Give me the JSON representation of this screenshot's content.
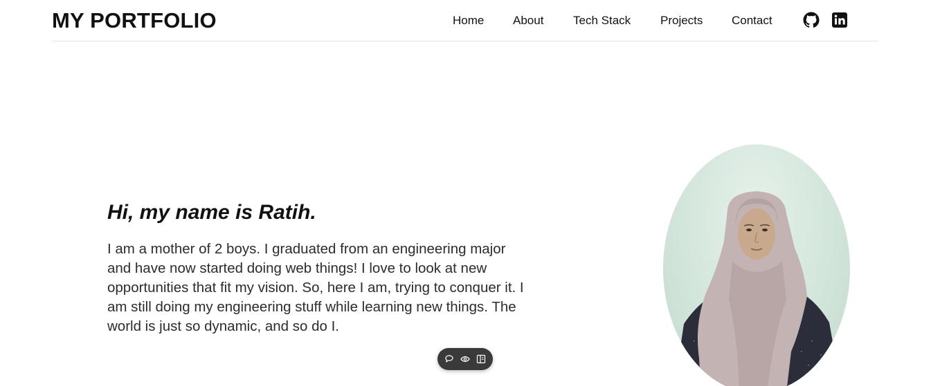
{
  "header": {
    "logo": "MY PORTFOLIO",
    "nav": [
      "Home",
      "About",
      "Tech Stack",
      "Projects",
      "Contact"
    ],
    "social_icons": [
      "github-icon",
      "linkedin-icon"
    ]
  },
  "intro": {
    "title": "Hi, my name is Ratih.",
    "text": "I am a mother of 2 boys. I graduated from an engineering major and have now started doing web things! I love to look at new opportunities that fit my vision. So, here I am, trying to conquer it. I am still doing my engineering stuff while learning new things. The world is just so dynamic, and so do I."
  },
  "profile_photo": {
    "image": "portrait-photo",
    "colors": {
      "background": "#d3e6dc",
      "hijab": "#c4b3b3",
      "clothing": "#2b2e3a"
    }
  },
  "toolbar": {
    "icons": [
      "comment-icon",
      "eye-icon",
      "panel-icon"
    ]
  },
  "colors": {
    "text_primary": "#111111",
    "text_body": "#2b2b33",
    "divider": "#e6e6e6",
    "toolbar_bg": "#3a3a3a"
  }
}
